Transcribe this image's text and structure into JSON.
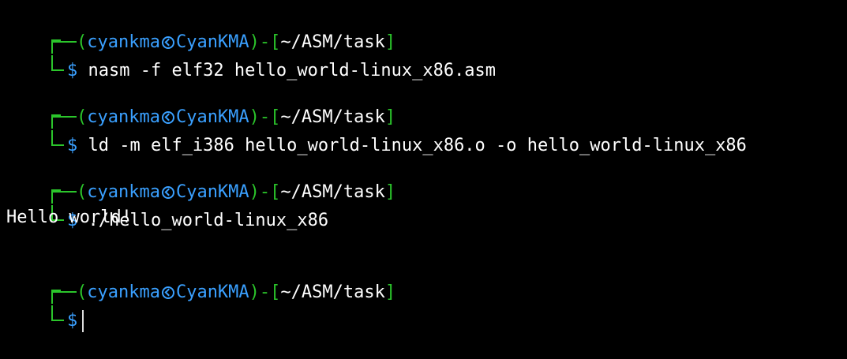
{
  "prompt": {
    "user": "cyankma",
    "host": "CyanKMA",
    "path": "~/ASM/task",
    "symbol": "$",
    "open_paren": "(",
    "close_paren_dash": ")-[",
    "close_bracket": "]",
    "separator_icon": "at-symbol-icon"
  },
  "colors": {
    "background": "#000000",
    "prompt_green": "#2bc52b",
    "prompt_blue": "#3aa0ff",
    "text": "#ffffff"
  },
  "blocks": [
    {
      "command": "nasm -f elf32 hello_world-linux_x86.asm",
      "output": ""
    },
    {
      "command": "ld -m elf_i386 hello_world-linux_x86.o -o hello_world-linux_x86",
      "output": ""
    },
    {
      "command": "./hello_world-linux_x86",
      "output": "Hello world!"
    },
    {
      "command": "",
      "output": ""
    }
  ]
}
